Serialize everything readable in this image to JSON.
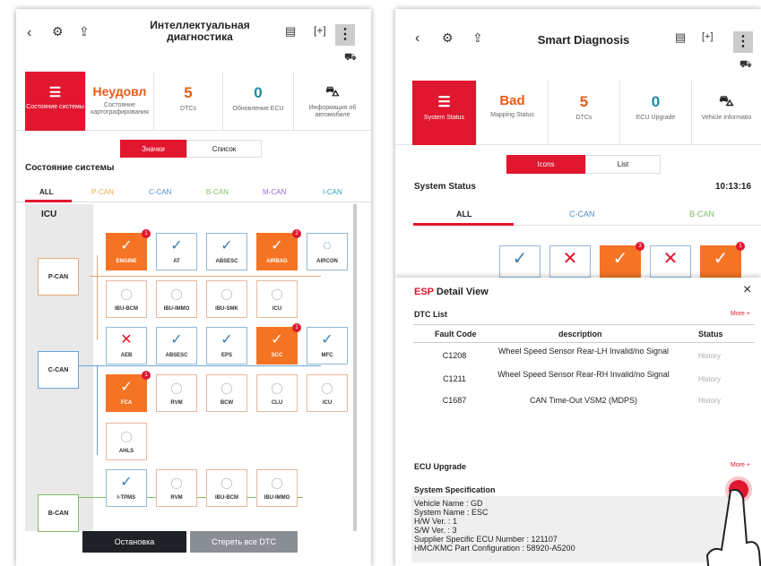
{
  "left": {
    "title": "Интеллектуальная\nдиагностика",
    "back_icon": "chevron-left-icon",
    "gear_icon": "gear-icon",
    "export_icon": "export-icon",
    "tool_icon": "report-icon",
    "scan_icon": "scan-icon",
    "car_icon": "car-icon",
    "more_icon": "more-icon",
    "more_glyph": "⋮",
    "stats": [
      {
        "label": "Состояние системы"
      },
      {
        "value": "Неудовл",
        "label": "Состояние картографирования"
      },
      {
        "value": "5",
        "label": "DTCs"
      },
      {
        "value": "0",
        "label": "Обновление ECU"
      },
      {
        "label": "Информация об автомобиле"
      }
    ],
    "toggle": [
      "Значки",
      "Список"
    ],
    "section": "Состояние системы",
    "tabs": [
      "ALL",
      "P-CAN",
      "C-CAN",
      "B-CAN",
      "M-CAN",
      "I-CAN"
    ],
    "icu": "ICU",
    "buses": [
      "P-CAN",
      "C-CAN",
      "B-CAN"
    ],
    "nodes": [
      {
        "n": "ENGINE",
        "s": "err",
        "b": "1"
      },
      {
        "n": "AT",
        "s": "ok"
      },
      {
        "n": "ABSESC",
        "s": "ok"
      },
      {
        "n": "AIRBAG",
        "s": "err",
        "b": "2"
      },
      {
        "n": "AIRCON",
        "s": "load"
      },
      {
        "n": "IBU-BCM",
        "s": "off"
      },
      {
        "n": "IBU-IMMO",
        "s": "off"
      },
      {
        "n": "IBU-SMK",
        "s": "off"
      },
      {
        "n": "ICU",
        "s": "off"
      },
      {
        "n": "AEB",
        "s": "x"
      },
      {
        "n": "ABSESC",
        "s": "ok"
      },
      {
        "n": "EPS",
        "s": "ok"
      },
      {
        "n": "SCC",
        "s": "err",
        "b": "1"
      },
      {
        "n": "MFC",
        "s": "ok"
      },
      {
        "n": "FCA",
        "s": "err",
        "b": "1"
      },
      {
        "n": "RVM",
        "s": "off"
      },
      {
        "n": "BCW",
        "s": "off"
      },
      {
        "n": "CLU",
        "s": "off"
      },
      {
        "n": "ICU",
        "s": "off"
      },
      {
        "n": "AHLS",
        "s": "off"
      },
      {
        "n": "I-TPMS",
        "s": "ok"
      },
      {
        "n": "RVM",
        "s": "off"
      },
      {
        "n": "IBU-BCM",
        "s": "off"
      },
      {
        "n": "IBU-IMMO",
        "s": "off"
      }
    ],
    "stop": "Остановка",
    "clear": "Стереть все DTC"
  },
  "right": {
    "title": "Smart Diagnosis",
    "more_glyph": "⋮",
    "stats": [
      {
        "label": "System Status"
      },
      {
        "value": "Bad",
        "label": "Mapping Status"
      },
      {
        "value": "5",
        "label": "DTCs"
      },
      {
        "value": "0",
        "label": "ECU Upgrade"
      },
      {
        "label": "Vehicle Informatio"
      }
    ],
    "toggle": [
      "Icons",
      "List"
    ],
    "section": "System Status",
    "time": "10:13:16",
    "tabs": [
      "ALL",
      "C-CAN",
      "B-CAN"
    ],
    "row": [
      {
        "s": "ok"
      },
      {
        "s": "x"
      },
      {
        "s": "err",
        "b": "3"
      },
      {
        "s": "x"
      },
      {
        "s": "err",
        "b": "1"
      }
    ],
    "detail": {
      "prefix": "ESP",
      "title": "Detail View",
      "close": "×",
      "dtc_list": "DTC List",
      "more": "More +",
      "cols": [
        "Fault Code",
        "description",
        "Status"
      ],
      "rows": [
        {
          "code": "C1208",
          "desc": "Wheel Speed Sensor Rear-LH Invalid/no Signal",
          "status": "History"
        },
        {
          "code": "C1211",
          "desc": "Wheel Speed Sensor Rear-RH Invalid/no Signal",
          "status": "History"
        },
        {
          "code": "C1687",
          "desc": "CAN Time-Out VSM2 (MDPS)",
          "status": "History"
        }
      ],
      "ecu": "ECU Upgrade",
      "ecu_more": "More +",
      "spec_title": "System Specification",
      "spec": [
        "Vehicle Name : GD",
        "System Name : ESC",
        "H/W Ver. : 1",
        "S/W Ver. : 3",
        "Supplier Specific ECU Number : 121107",
        "HMC/KMC Part Configuration : 58920-A5200"
      ]
    }
  },
  "colors": {
    "accent": "#e1162f",
    "error": "#f47424",
    "ok": "#3d7fb3"
  }
}
